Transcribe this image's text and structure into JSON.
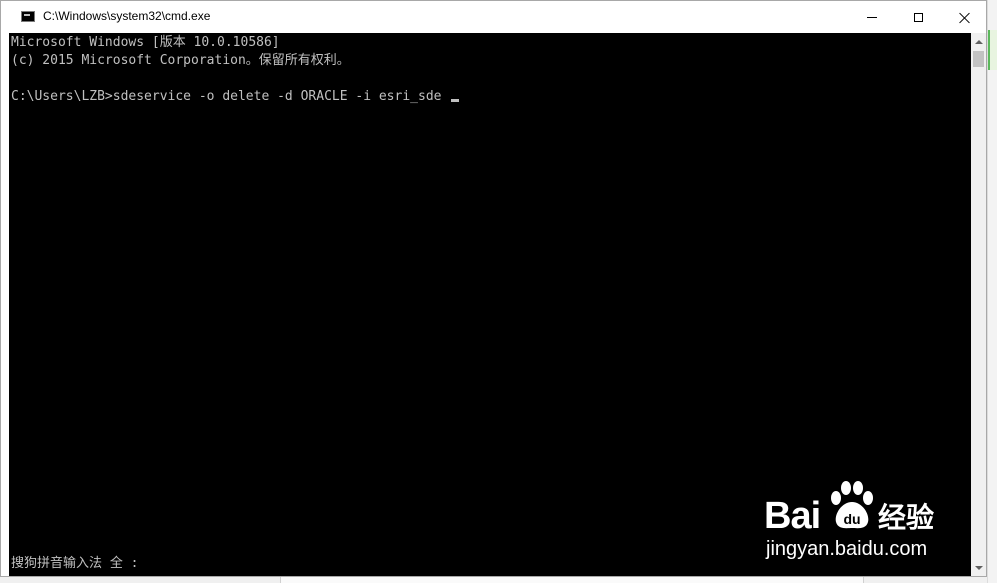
{
  "window": {
    "title": "C:\\Windows\\system32\\cmd.exe",
    "icon": "console-icon"
  },
  "controls": {
    "minimize": "minimize-icon",
    "maximize": "maximize-icon",
    "close": "close-icon"
  },
  "console": {
    "lines": [
      "Microsoft Windows [版本 10.0.10586]",
      "(c) 2015 Microsoft Corporation。保留所有权利。",
      "C:\\Users\\LZB>sdeservice -o delete -d ORACLE -i esri_sde "
    ],
    "ime_status": "搜狗拼音输入法 全 :",
    "background": "#000000",
    "foreground": "#c0c0c0"
  },
  "watermark": {
    "brand": "Bai",
    "brand_du": "du",
    "product": "经验",
    "url": "jingyan.baidu.com"
  }
}
